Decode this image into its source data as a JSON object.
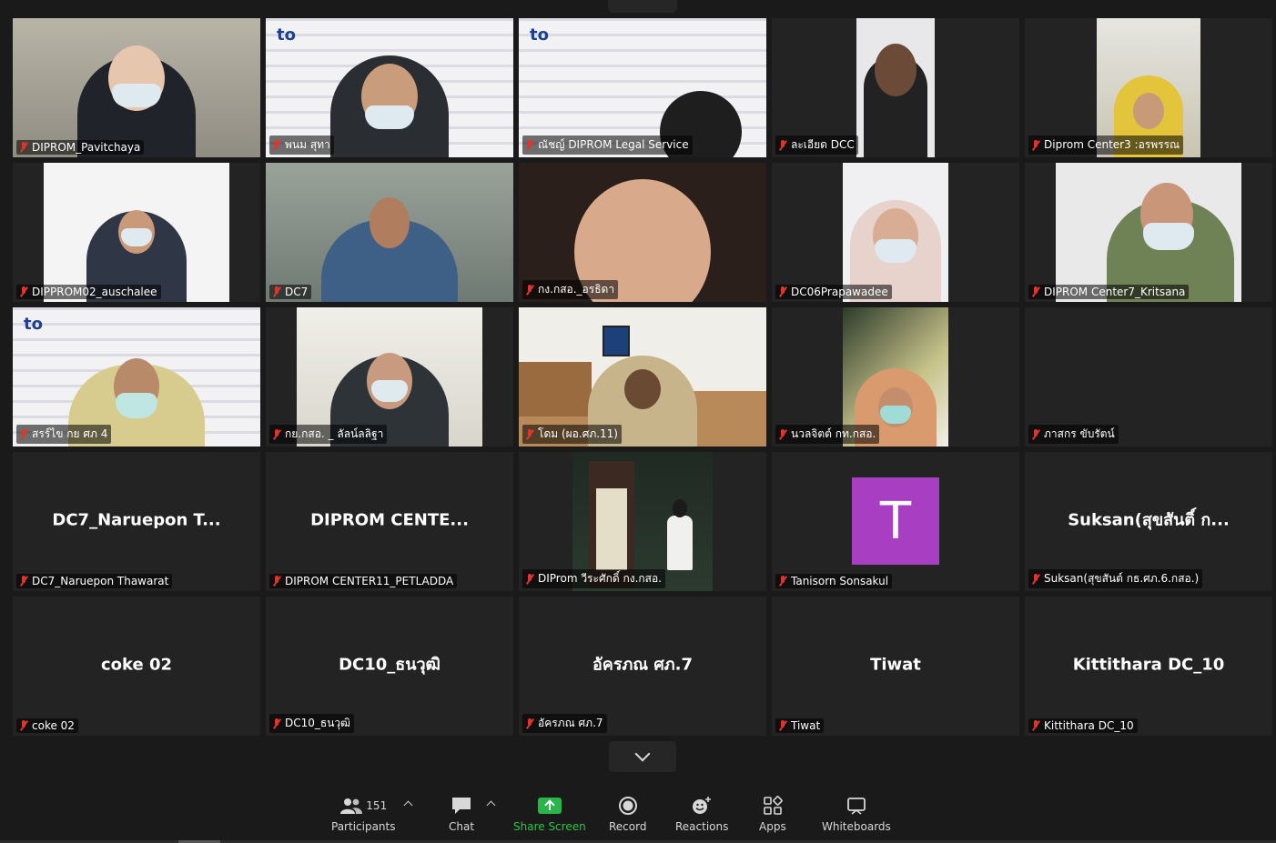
{
  "tiles": [
    {
      "label": "DIPROM_Pavitchaya",
      "big": ""
    },
    {
      "label": "พนม สุทา",
      "big": ""
    },
    {
      "label": "ณัชญ์ DIPROM Legal Service",
      "big": ""
    },
    {
      "label": "ละเอียด DCC",
      "big": ""
    },
    {
      "label": "Diprom Center3 :อรพรรณ",
      "big": ""
    },
    {
      "label": "DIPPROM02_auschalee",
      "big": ""
    },
    {
      "label": "DC7",
      "big": ""
    },
    {
      "label": "กง.กสอ._อรธิดา",
      "big": ""
    },
    {
      "label": "DC06Prapawadee",
      "big": ""
    },
    {
      "label": "DIPROM Center7_Kritsana",
      "big": ""
    },
    {
      "label": "สรร์ไข กย ศภ 4",
      "big": ""
    },
    {
      "label": "กย.กสอ. _ ลัลน์ลลิฐา",
      "big": ""
    },
    {
      "label": "โดม (ผอ.ศภ.11)",
      "big": ""
    },
    {
      "label": "นวลจิตต์ กท.กสอ.",
      "big": ""
    },
    {
      "label": "ภาสกร ขับรัตน์",
      "big": ""
    },
    {
      "label": "DC7_Naruepon Thawarat",
      "big": "DC7_Naruepon  T..."
    },
    {
      "label": "DIPROM CENTER11_PETLADDA",
      "big": "DIPROM  CENTE..."
    },
    {
      "label": "DIProm วีระศักดิ์ กง.กสอ.",
      "big": ""
    },
    {
      "label": "Tanisorn Sonsakul",
      "big": "",
      "avatar": "T"
    },
    {
      "label": "Suksan(สุขสันต์ กธ.ศภ.6.กสอ.)",
      "big": "Suksan(สุขสันติ์ ก..."
    },
    {
      "label": "coke 02",
      "big": "coke 02"
    },
    {
      "label": "DC10_ธนวุฒิ",
      "big": "DC10_ธนวุฒิ"
    },
    {
      "label": "อัครภณ ศภ.7",
      "big": "อัครภณ ศภ.7"
    },
    {
      "label": "Tiwat",
      "big": "Tiwat"
    },
    {
      "label": "Kittithara DC_10",
      "big": "Kittithara DC_10"
    }
  ],
  "toolbar": {
    "participants_count": "151",
    "participants_label": "Participants",
    "chat_label": "Chat",
    "share_label": "Share Screen",
    "record_label": "Record",
    "reactions_label": "Reactions",
    "apps_label": "Apps",
    "whiteboards_label": "Whiteboards"
  },
  "colors": {
    "avatar": "#a83fc3",
    "share": "#2ab54a",
    "muted": "#e0352b"
  }
}
